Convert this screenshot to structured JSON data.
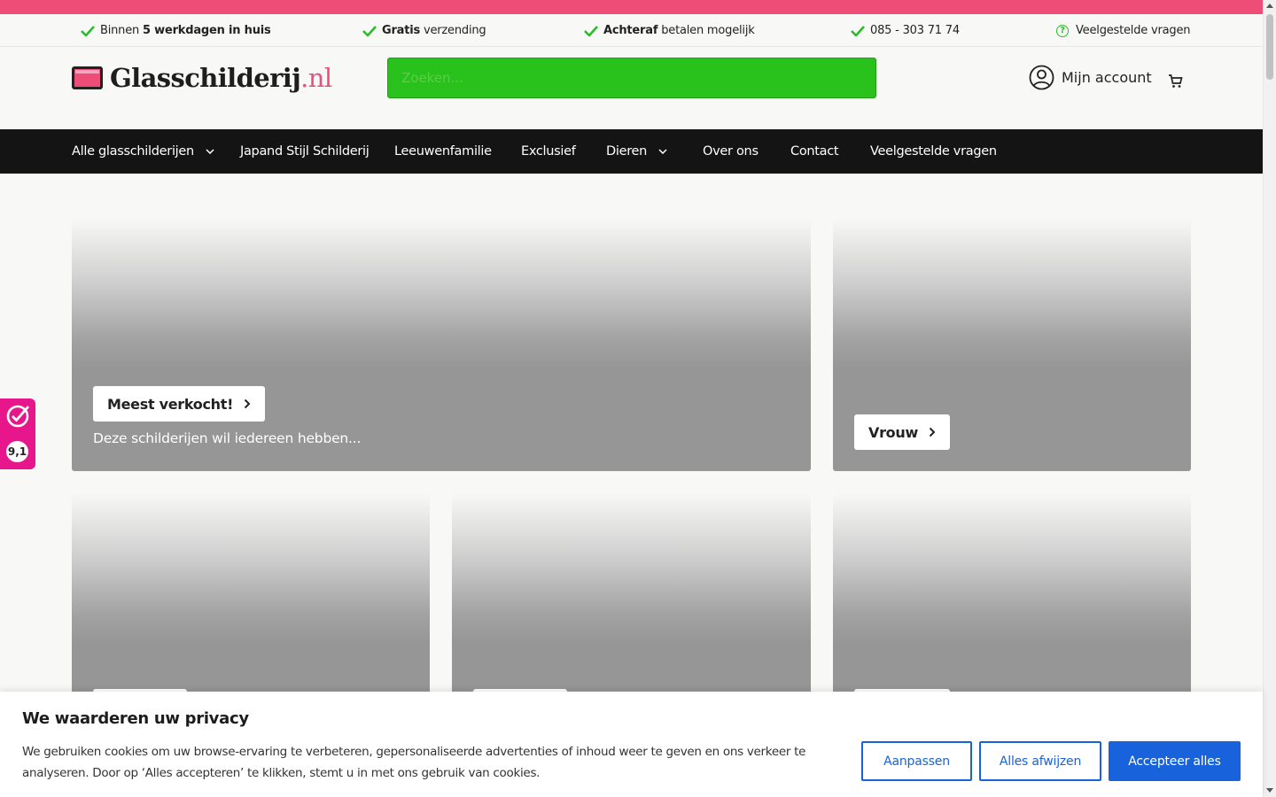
{
  "usp": [
    {
      "pre": "Binnen ",
      "bold": "5 werkdagen in huis",
      "post": ""
    },
    {
      "pre": "",
      "bold": "Gratis",
      "post": " verzending"
    },
    {
      "pre": "",
      "bold": "Achteraf",
      "post": " betalen mogelijk"
    },
    {
      "pre": "",
      "bold": "",
      "post": "085 - 303 71 74"
    },
    {
      "pre": "",
      "bold": "",
      "post": "Veelgestelde vragen"
    }
  ],
  "logo": {
    "name": "Glasschilderij",
    "tld": ".nl"
  },
  "search": {
    "placeholder": "Zoeken..."
  },
  "account": {
    "label": "Mijn account"
  },
  "nav": [
    {
      "label": "Alle glasschilderijen"
    },
    {
      "label": "Japand Stijl Schilderij"
    },
    {
      "label": "Leeuwenfamilie"
    },
    {
      "label": "Exclusief"
    },
    {
      "label": "Dieren"
    },
    {
      "label": "Over ons"
    },
    {
      "label": "Contact"
    },
    {
      "label": "Veelgestelde vragen"
    }
  ],
  "tiles": {
    "main": {
      "button": "Meest verkocht!",
      "sub": "Deze schilderijen wil iedereen hebben..."
    },
    "side": {
      "button": "Vrouw"
    }
  },
  "rating": {
    "value": "9,1"
  },
  "cookie": {
    "title": "We waarderen uw privacy",
    "text": "We gebruiken cookies om uw browse-ervaring te verbeteren, gepersonaliseerde advertenties of inhoud weer te geven en ons verkeer te analyseren. Door op ‘Alles accepteren’ te klikken, stemt u in met ons gebruik van cookies.",
    "customize": "Aanpassen",
    "reject": "Alles afwijzen",
    "accept": "Accepteer alles"
  },
  "colors": {
    "accent_pink": "#ee4d78",
    "search_green": "#29c11b",
    "check_green": "#2cbb2c",
    "nav_bg": "#141414",
    "cookie_blue": "#1863dc",
    "rating_pink": "#e7178b"
  }
}
